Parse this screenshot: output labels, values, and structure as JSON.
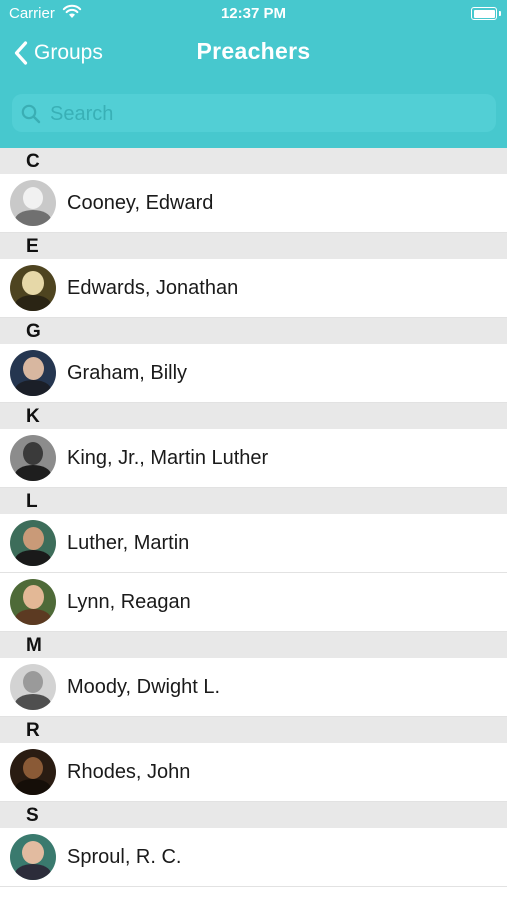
{
  "status_bar": {
    "carrier": "Carrier",
    "time": "12:37 PM"
  },
  "nav": {
    "back_label": "Groups",
    "title": "Preachers"
  },
  "search": {
    "placeholder": "Search",
    "value": ""
  },
  "sections": [
    {
      "letter": "C",
      "rows": [
        {
          "name": "Cooney, Edward"
        }
      ]
    },
    {
      "letter": "E",
      "rows": [
        {
          "name": "Edwards, Jonathan"
        }
      ]
    },
    {
      "letter": "G",
      "rows": [
        {
          "name": "Graham, Billy"
        }
      ]
    },
    {
      "letter": "K",
      "rows": [
        {
          "name": "King, Jr., Martin Luther"
        }
      ]
    },
    {
      "letter": "L",
      "rows": [
        {
          "name": "Luther, Martin"
        },
        {
          "name": "Lynn, Reagan"
        }
      ]
    },
    {
      "letter": "M",
      "rows": [
        {
          "name": "Moody, Dwight L."
        }
      ]
    },
    {
      "letter": "R",
      "rows": [
        {
          "name": "Rhodes, John"
        }
      ]
    },
    {
      "letter": "S",
      "rows": [
        {
          "name": "Sproul, R. C."
        }
      ]
    }
  ],
  "colors": {
    "header_bg": "#47c8ce",
    "search_bg": "#52cfd5",
    "section_bg": "#e8e8e8"
  }
}
